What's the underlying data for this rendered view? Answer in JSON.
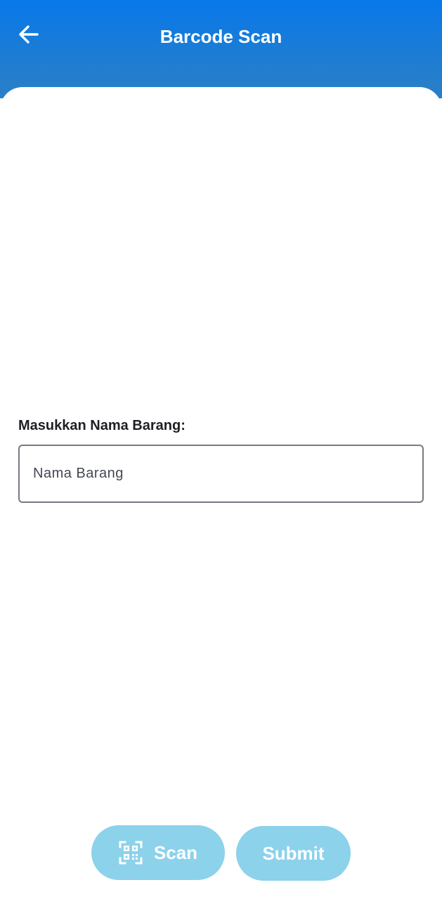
{
  "header": {
    "title": "Barcode Scan",
    "back_icon": "arrow-left-icon",
    "gradient_top": "#0878ea",
    "gradient_bottom": "#287fc8"
  },
  "form": {
    "label": "Masukkan Nama Barang:",
    "input_value": "",
    "input_placeholder": "Nama Barang"
  },
  "actions": {
    "scan_label": "Scan",
    "scan_icon": "qr-code-scan-icon",
    "submit_label": "Submit",
    "button_color": "#8cd2eb"
  }
}
